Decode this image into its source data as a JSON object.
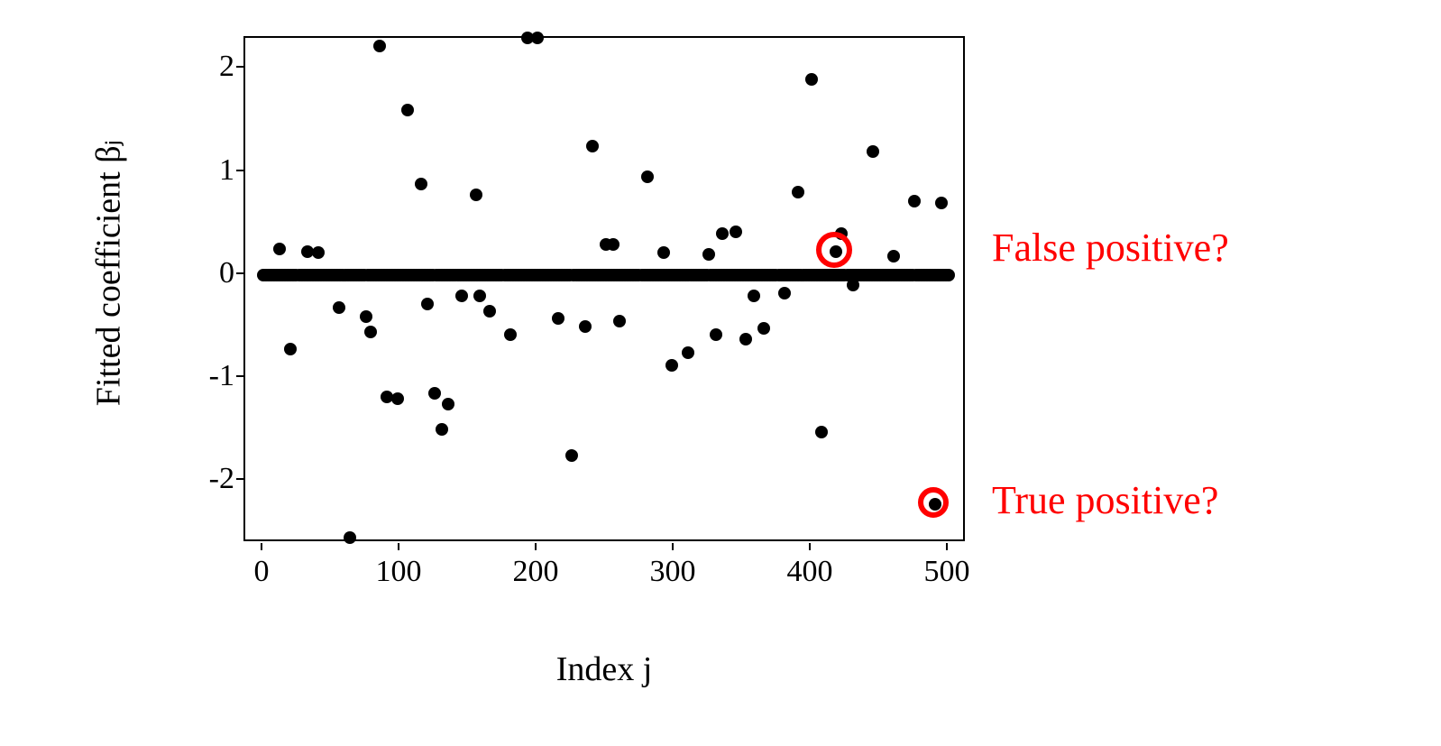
{
  "chart_data": {
    "type": "scatter",
    "title": "",
    "xlabel": "Index j",
    "ylabel": "Fitted coefficient βⱼ",
    "xlim": [
      0,
      500
    ],
    "ylim": [
      -2.6,
      2.3
    ],
    "x_ticks": [
      0,
      100,
      200,
      300,
      400,
      500
    ],
    "y_ticks": [
      -2,
      -1,
      0,
      1,
      2
    ],
    "zero_line_indices": 500,
    "scatter_points": [
      {
        "x": 12,
        "y": 0.25
      },
      {
        "x": 20,
        "y": -0.72
      },
      {
        "x": 32,
        "y": 0.23
      },
      {
        "x": 40,
        "y": 0.22
      },
      {
        "x": 55,
        "y": -0.32
      },
      {
        "x": 63,
        "y": -2.55
      },
      {
        "x": 75,
        "y": -0.4
      },
      {
        "x": 78,
        "y": -0.55
      },
      {
        "x": 85,
        "y": 2.22
      },
      {
        "x": 90,
        "y": -1.18
      },
      {
        "x": 98,
        "y": -1.2
      },
      {
        "x": 105,
        "y": 1.6
      },
      {
        "x": 115,
        "y": 0.88
      },
      {
        "x": 120,
        "y": -0.28
      },
      {
        "x": 125,
        "y": -1.15
      },
      {
        "x": 130,
        "y": -1.5
      },
      {
        "x": 135,
        "y": -1.25
      },
      {
        "x": 145,
        "y": -0.2
      },
      {
        "x": 155,
        "y": 0.78
      },
      {
        "x": 158,
        "y": -0.2
      },
      {
        "x": 165,
        "y": -0.35
      },
      {
        "x": 180,
        "y": -0.58
      },
      {
        "x": 193,
        "y": 2.3
      },
      {
        "x": 200,
        "y": 2.3
      },
      {
        "x": 215,
        "y": -0.42
      },
      {
        "x": 225,
        "y": -1.75
      },
      {
        "x": 235,
        "y": -0.5
      },
      {
        "x": 240,
        "y": 1.25
      },
      {
        "x": 250,
        "y": 0.3
      },
      {
        "x": 255,
        "y": 0.3
      },
      {
        "x": 260,
        "y": -0.45
      },
      {
        "x": 280,
        "y": 0.95
      },
      {
        "x": 292,
        "y": 0.22
      },
      {
        "x": 298,
        "y": -0.88
      },
      {
        "x": 310,
        "y": -0.75
      },
      {
        "x": 325,
        "y": 0.2
      },
      {
        "x": 330,
        "y": -0.58
      },
      {
        "x": 335,
        "y": 0.4
      },
      {
        "x": 345,
        "y": 0.42
      },
      {
        "x": 352,
        "y": -0.62
      },
      {
        "x": 358,
        "y": -0.2
      },
      {
        "x": 365,
        "y": -0.52
      },
      {
        "x": 380,
        "y": -0.18
      },
      {
        "x": 390,
        "y": 0.8
      },
      {
        "x": 400,
        "y": 1.9
      },
      {
        "x": 407,
        "y": -1.52
      },
      {
        "x": 418,
        "y": 0.23
      },
      {
        "x": 422,
        "y": 0.4
      },
      {
        "x": 430,
        "y": -0.1
      },
      {
        "x": 445,
        "y": 1.2
      },
      {
        "x": 460,
        "y": 0.18
      },
      {
        "x": 475,
        "y": 0.72
      },
      {
        "x": 490,
        "y": -2.22
      },
      {
        "x": 495,
        "y": 0.7
      }
    ],
    "annotations": [
      {
        "x": 418,
        "y": 0.23,
        "label": "False positive?",
        "radius": 20
      },
      {
        "x": 490,
        "y": -2.22,
        "label": "True positive?",
        "radius": 17
      }
    ]
  }
}
